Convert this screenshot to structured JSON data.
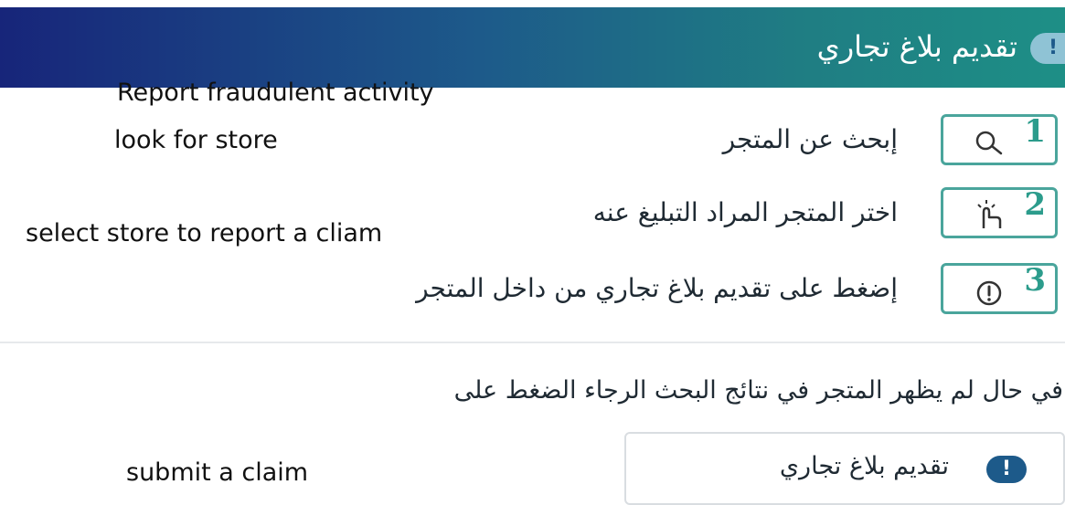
{
  "header": {
    "title": "تقديم بلاغ تجاري",
    "icon": "exclamation-icon"
  },
  "subtitle_en": "Report fraudulent activity",
  "steps": [
    {
      "number": "1",
      "icon": "search-icon",
      "label_ar": "إبحث عن المتجر",
      "label_en": "look for store"
    },
    {
      "number": "2",
      "icon": "tap-icon",
      "label_ar": "اختر المتجر المراد التبليغ عنه",
      "label_en": "select store to report a cliam"
    },
    {
      "number": "3",
      "icon": "alert-icon",
      "label_ar": "إضغط على تقديم بلاغ تجاري من داخل المتجر",
      "label_en": ""
    }
  ],
  "notice_ar": "في حال لم يظهر المتجر في نتائج البحث الرجاء الضغط على",
  "claim": {
    "label_en": "submit a claim",
    "button_label": "تقديم بلاغ تجاري",
    "icon": "exclamation-icon"
  },
  "colors": {
    "header_start": "#17257a",
    "header_end": "#1e8f86",
    "accent": "#2c9c8c",
    "button_icon": "#1d5a8a"
  }
}
